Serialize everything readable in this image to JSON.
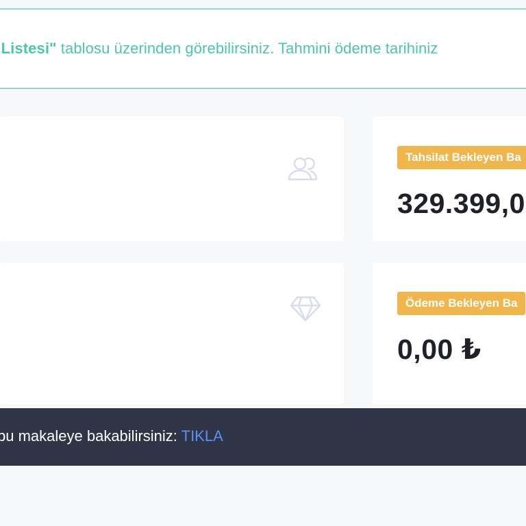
{
  "notice": {
    "bold_text": "t Listesi\"",
    "text": " tablosu üzerinden görebilirsiniz. Tahmini ödeme tarihiniz"
  },
  "icons": {
    "users": "users-icon",
    "diamond": "diamond-icon"
  },
  "cards": {
    "collection": {
      "badge": "Tahsilat Bekleyen Ba",
      "amount": "329.399,0"
    },
    "payment": {
      "badge": "Ödeme Bekleyen Ba",
      "amount": "0,00 ₺"
    }
  },
  "banner": {
    "text": "bu makaleye bakabilirsiniz: ",
    "link": "TIKLA"
  },
  "colors": {
    "accent_teal": "#4cc5ad",
    "badge_orange": "#f1b64b",
    "banner_bg": "#2f3547",
    "link_blue": "#5b8ff5"
  }
}
